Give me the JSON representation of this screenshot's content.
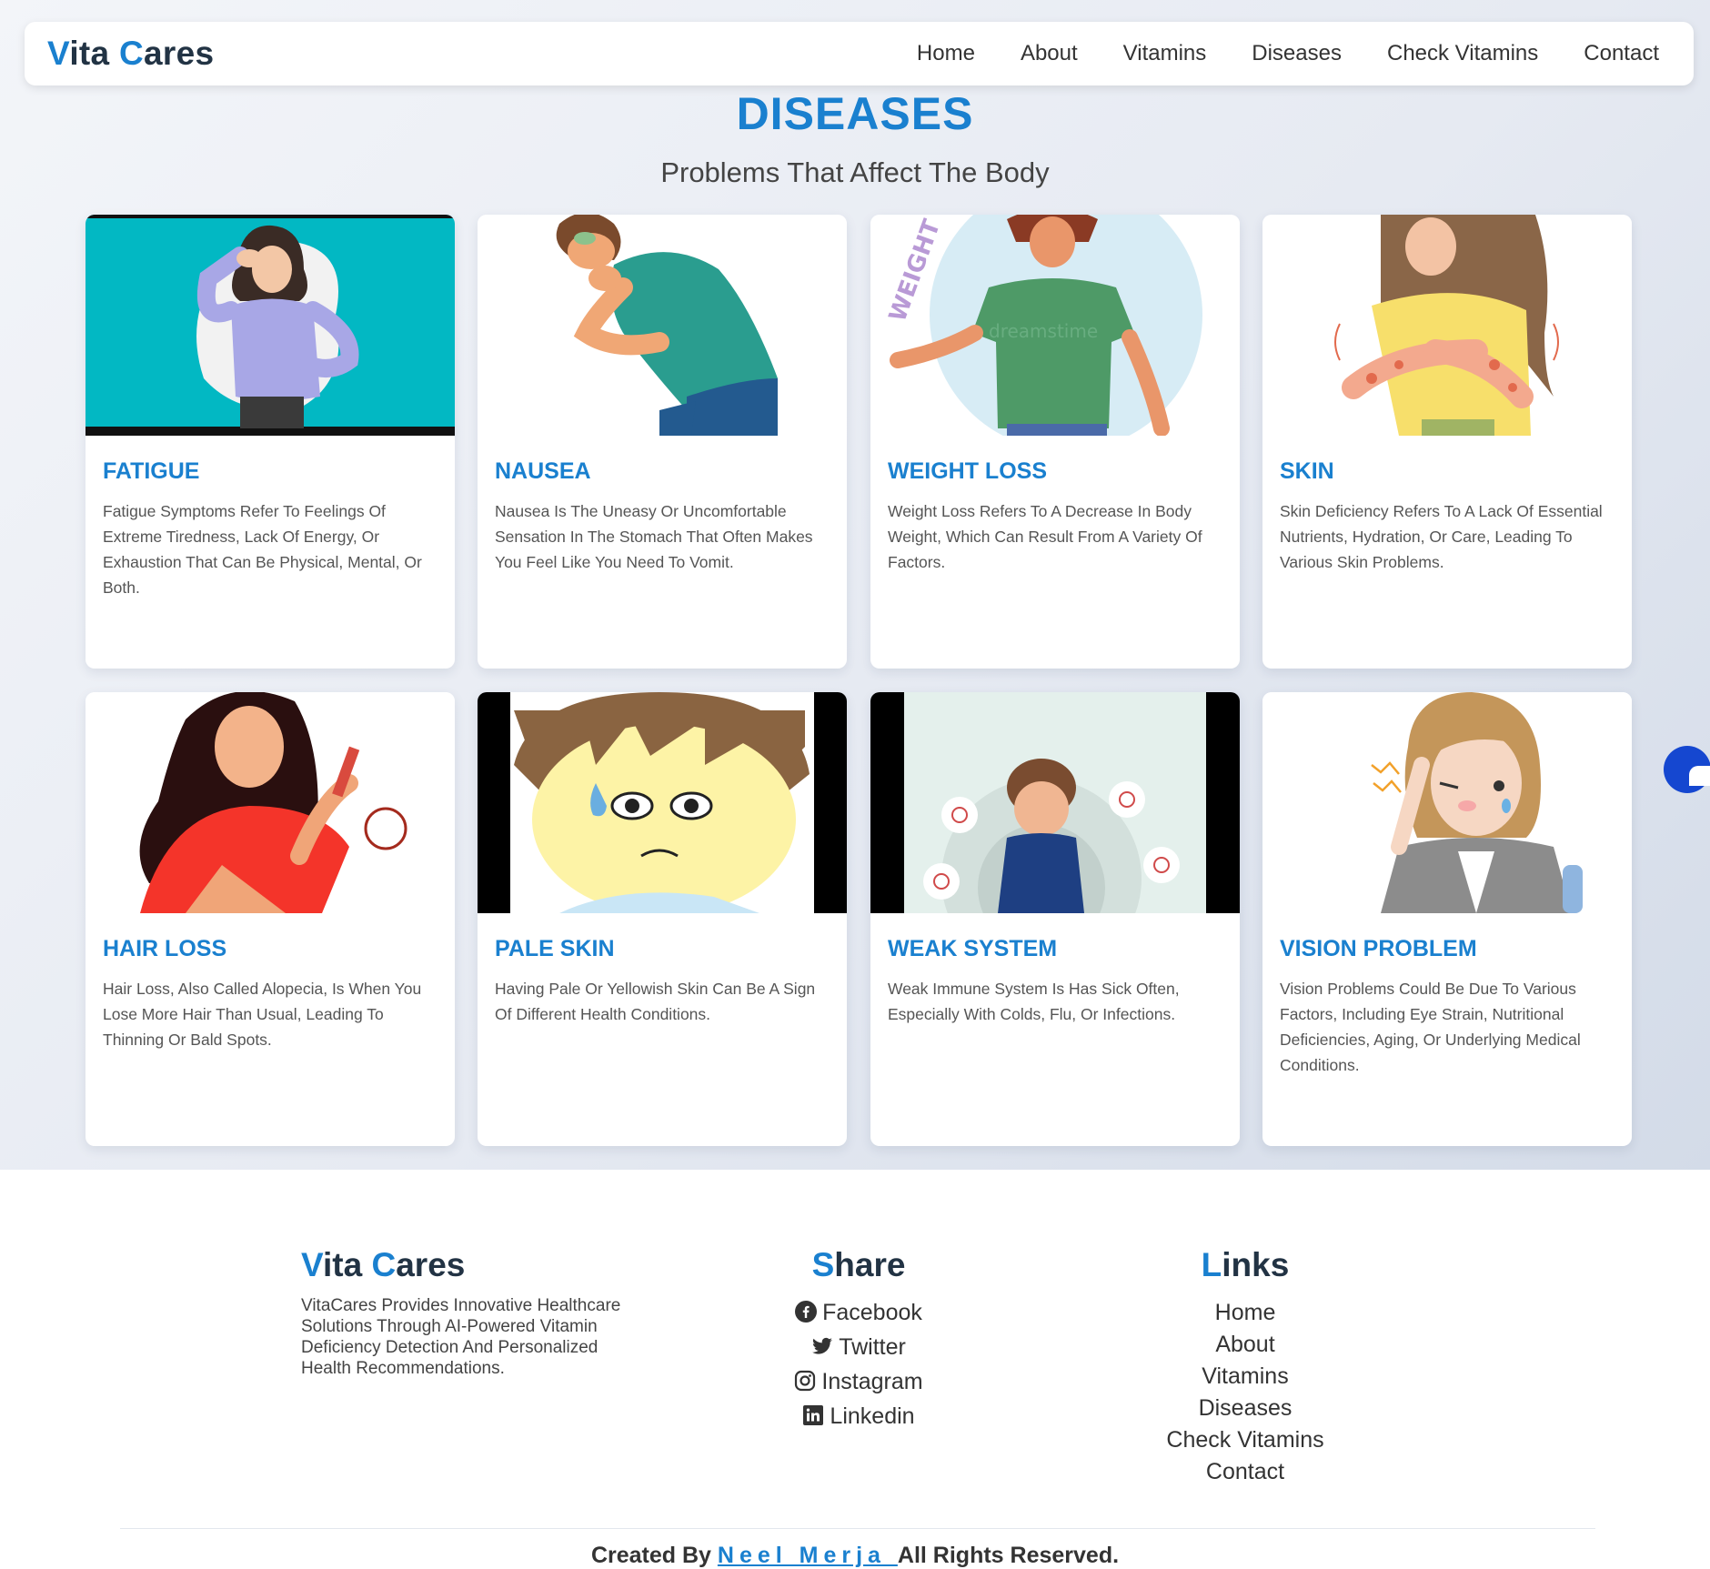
{
  "navbar": {
    "brand_first_letter": "V",
    "brand_rest_1": "ita ",
    "brand_second_letter": "C",
    "brand_rest_2": "ares",
    "links": [
      "Home",
      "About",
      "Vitamins",
      "Diseases",
      "Check Vitamins",
      "Contact"
    ]
  },
  "page": {
    "title": "DISEASES",
    "subtitle": "Problems That Affect The Body"
  },
  "cards": [
    {
      "title": "FATIGUE",
      "description": "Fatigue Symptoms Refer To Feelings Of Extreme Tiredness, Lack Of Energy, Or Exhaustion That Can Be Physical, Mental, Or Both."
    },
    {
      "title": "NAUSEA",
      "description": "Nausea Is The Uneasy Or Uncomfortable Sensation In The Stomach That Often Makes You Feel Like You Need To Vomit."
    },
    {
      "title": "WEIGHT LOSS",
      "description": "Weight Loss Refers To A Decrease In Body Weight, Which Can Result From A Variety Of Factors."
    },
    {
      "title": "SKIN",
      "description": "Skin Deficiency Refers To A Lack Of Essential Nutrients, Hydration, Or Care, Leading To Various Skin Problems."
    },
    {
      "title": "HAIR LOSS",
      "description": "Hair Loss, Also Called Alopecia, Is When You Lose More Hair Than Usual, Leading To Thinning Or Bald Spots."
    },
    {
      "title": "PALE SKIN",
      "description": "Having Pale Or Yellowish Skin Can Be A Sign Of Different Health Conditions."
    },
    {
      "title": "WEAK SYSTEM",
      "description": "Weak Immune System Is Has Sick Often, Especially With Colds, Flu, Or Infections."
    },
    {
      "title": "VISION PROBLEM",
      "description": "Vision Problems Could Be Due To Various Factors, Including Eye Strain, Nutritional Deficiencies, Aging, Or Underlying Medical Conditions."
    }
  ],
  "illustration_text": {
    "weight_loss_arc": "WEIGHT LOSS",
    "watermark": "dreamstime"
  },
  "footer": {
    "description": "VitaCares Provides Innovative Healthcare Solutions Through AI-Powered Vitamin Deficiency Detection And Personalized Health Recommendations.",
    "share_first_letter": "S",
    "share_rest": "hare",
    "share_items": [
      {
        "label": "Facebook",
        "icon": "facebook-icon"
      },
      {
        "label": "Twitter",
        "icon": "twitter-icon"
      },
      {
        "label": "Instagram",
        "icon": "instagram-icon"
      },
      {
        "label": "Linkedin",
        "icon": "linkedin-icon"
      }
    ],
    "links_first_letter": "L",
    "links_rest": "inks",
    "links": [
      "Home",
      "About",
      "Vitamins",
      "Diseases",
      "Check Vitamins",
      "Contact"
    ],
    "credits_prefix": "Created By ",
    "credits_name": "Neel Merja ",
    "credits_suffix": "All Rights Reserved."
  },
  "colors": {
    "accent": "#1a80cf",
    "dark_text": "#223344",
    "chat_button": "#1547d0"
  }
}
